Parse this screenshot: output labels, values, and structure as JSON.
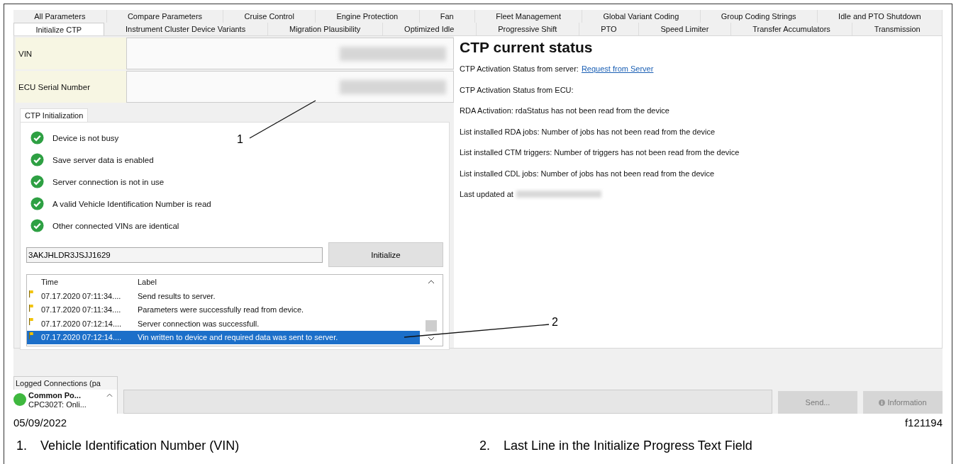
{
  "tab_rows": [
    [
      {
        "label": "All Parameters",
        "selected": false
      },
      {
        "label": "Compare Parameters",
        "selected": false
      },
      {
        "label": "Cruise Control",
        "selected": false
      },
      {
        "label": "Engine Protection",
        "selected": false
      },
      {
        "label": "Fan",
        "selected": false
      },
      {
        "label": "Fleet Management",
        "selected": false
      },
      {
        "label": "Global Variant Coding",
        "selected": false
      },
      {
        "label": "Group Coding Strings",
        "selected": false
      },
      {
        "label": "Idle and PTO Shutdown",
        "selected": false
      }
    ],
    [
      {
        "label": "Initialize CTP",
        "selected": true
      },
      {
        "label": "Instrument Cluster Device Variants",
        "selected": false
      },
      {
        "label": "Migration Plausibility",
        "selected": false
      },
      {
        "label": "Optimized Idle",
        "selected": false
      },
      {
        "label": "Progressive Shift",
        "selected": false
      },
      {
        "label": "PTO",
        "selected": false
      },
      {
        "label": "Speed Limiter",
        "selected": false
      },
      {
        "label": "Transfer Accumulators",
        "selected": false
      },
      {
        "label": "Transmission",
        "selected": false
      }
    ]
  ],
  "fields": [
    {
      "label": "VIN"
    },
    {
      "label": "ECU Serial Number"
    }
  ],
  "ctp_initialization": {
    "tab": "CTP Initialization",
    "checks": [
      {
        "text": "Device is not busy",
        "passed": true
      },
      {
        "text": "Save server data is enabled",
        "passed": true
      },
      {
        "text": "Server connection is not in use",
        "passed": true
      },
      {
        "text": "A valid Vehicle Identification Number is read",
        "passed": true
      },
      {
        "text": "Other connected VINs are identical",
        "passed": true
      }
    ],
    "vin_input": {
      "value": "3AKJHLDR3JSJJ1629"
    },
    "initialize_button": "Initialize",
    "log": {
      "columns": [
        "Time",
        "Label"
      ],
      "rows": [
        {
          "time": "07.17.2020 07:11:34....",
          "label": "Send results to server.",
          "selected": false
        },
        {
          "time": "07.17.2020 07:11:34....",
          "label": "Parameters were successfully read from device.",
          "selected": false
        },
        {
          "time": "07.17.2020 07:12:14....",
          "label": "Server connection was successfull.",
          "selected": false
        },
        {
          "time": "07.17.2020 07:12:14....",
          "label": "Vin written to device and required data was sent to server.",
          "selected": true
        }
      ]
    }
  },
  "status": {
    "title": "CTP current status",
    "lines": [
      {
        "kind": "link",
        "text": "CTP Activation Status from server:",
        "link": "Request from Server"
      },
      {
        "kind": "text",
        "text": "CTP Activation Status from ECU:"
      },
      {
        "kind": "text",
        "text": "RDA Activation: rdaStatus has not been read from the device"
      },
      {
        "kind": "text",
        "text": "List installed RDA jobs: Number of jobs has not been read from the device"
      },
      {
        "kind": "text",
        "text": "List installed CTM triggers: Number of triggers has not been read from the device"
      },
      {
        "kind": "text",
        "text": "List installed CDL jobs: Number of jobs has not been read from the device"
      },
      {
        "kind": "redacted",
        "text": "Last updated at"
      }
    ]
  },
  "connections": {
    "tab": "Logged Connections (pa",
    "items": [
      {
        "name": "Common Po...",
        "status": "CPC302T: Onli...",
        "online": true
      }
    ]
  },
  "toolbar": {
    "buttons": [
      {
        "label": "Send...",
        "disabled": true,
        "kind": "plain"
      },
      {
        "label": "Information",
        "disabled": true,
        "kind": "info"
      }
    ]
  },
  "footer": {
    "date": "05/09/2022",
    "figure_id": "f121194"
  },
  "callouts": [
    {
      "number": "1",
      "marker": "1.",
      "text": "Vehicle Identification Number (VIN)"
    },
    {
      "number": "2",
      "marker": "2.",
      "text": "Last Line in the Initialize Progress Text Field"
    }
  ]
}
